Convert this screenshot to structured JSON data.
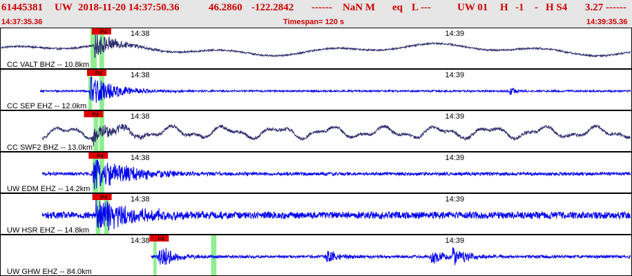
{
  "header": {
    "event_id": "61445381",
    "network": "UW",
    "origin_time": "2018-11-20 14:37:50.36",
    "lat": "46.2860",
    "lon": "-122.2842",
    "depth": "------",
    "mag": "NaN M",
    "etype": "eq",
    "gtype": "L ---",
    "source": "UW 01",
    "qual": "H",
    "status": "-1",
    "dash": "-",
    "subsource": "H S4",
    "last": "3.27 ------"
  },
  "window": {
    "start_label": "14:37:35.36",
    "timespan_label": "Timespan= 120 s",
    "end_label": "14:39:35.36"
  },
  "colors": {
    "header_bg": "#e6e6e6",
    "header_text": "#cc0000",
    "pick_flag": "#dd0000",
    "pick_window": "#90ee90",
    "trace_dark": "#2b2b6e",
    "trace_blue": "#0000ee"
  },
  "chart_data": {
    "type": "line",
    "title": "61445381 UW 2018-11-20 14:37:50.36",
    "x_unit": "seconds from 14:37:35.36",
    "xlim": [
      0,
      120
    ],
    "time_ticks": [
      {
        "label": "14:38",
        "t": 24.64
      },
      {
        "label": "14:39",
        "t": 84.64
      }
    ],
    "series": [
      {
        "name": "CC VALT BHZ -- 10.8km",
        "color": "#2b2b6e",
        "trace_start": 0,
        "pick_label": "P4",
        "pick_t": 17.5,
        "green_bands": [
          [
            17.0,
            18.2
          ],
          [
            18.7,
            19.6
          ]
        ],
        "bursts": [
          {
            "t": 17.8,
            "amp": 0.75,
            "decay": 4
          }
        ],
        "drift": "long",
        "base_noise": 0.05
      },
      {
        "name": "CC SEP EHZ -- 12.0km",
        "color": "#0000ee",
        "trace_start": 7.4,
        "pick_label": "P4",
        "pick_t": 16.6,
        "green_bands": [
          [
            16.6,
            17.3
          ],
          [
            18.7,
            19.6
          ]
        ],
        "bursts": [
          {
            "t": 16.9,
            "amp": 0.9,
            "decay": 5
          },
          {
            "t": 97.0,
            "amp": 0.25,
            "decay": 1.2
          }
        ],
        "drift": "none",
        "base_noise": 0.05
      },
      {
        "name": "CC SWF2 BHZ -- 13.0km",
        "color": "#2b2b6e",
        "trace_start": 7.7,
        "pick_label": "P4",
        "pick_t": 16.0,
        "green_bands": [
          [
            17.6,
            18.5
          ],
          [
            18.7,
            19.6
          ]
        ],
        "bursts": [
          {
            "t": 17.5,
            "amp": 0.55,
            "decay": 5
          }
        ],
        "drift": "short",
        "base_noise": 0.09
      },
      {
        "name": "UW EDM EHZ -- 14.2km",
        "color": "#0000ee",
        "trace_start": 7.8,
        "pick_label": "P4",
        "pick_t": 16.9,
        "green_bands": [
          [
            17.4,
            18.5
          ],
          [
            18.7,
            19.6
          ]
        ],
        "bursts": [
          {
            "t": 17.5,
            "amp": 0.95,
            "decay": 8
          }
        ],
        "drift": "none",
        "base_noise": 0.09
      },
      {
        "name": "UW HSR EHZ -- 14.8km",
        "color": "#0000ee",
        "trace_start": 7.8,
        "pick_label": "P4",
        "pick_t": 17.6,
        "green_bands": [
          [
            18.0,
            18.9
          ],
          [
            19.6,
            20.5
          ]
        ],
        "bursts": [
          {
            "t": 18.0,
            "amp": 0.95,
            "decay": 8
          }
        ],
        "drift": "none",
        "base_noise": 0.2
      },
      {
        "name": "UW GHW EHZ -- 84.0km",
        "color": "#0000ee",
        "trace_start": 28.6,
        "pick_label": "P4",
        "pick_t": 28.5,
        "green_bands": [
          [
            29.0,
            29.6
          ],
          [
            40.0,
            41.0
          ]
        ],
        "bursts": [
          {
            "t": 30.0,
            "amp": 0.7,
            "decay": 3
          },
          {
            "t": 62.0,
            "amp": 0.45,
            "decay": 2.5
          },
          {
            "t": 82.0,
            "amp": 0.4,
            "decay": 3
          },
          {
            "t": 86.0,
            "amp": 0.55,
            "decay": 3
          }
        ],
        "drift": "none",
        "base_noise": 0.08
      }
    ]
  }
}
